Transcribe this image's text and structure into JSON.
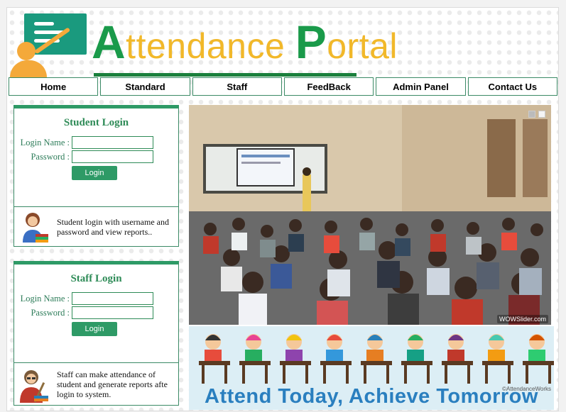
{
  "header": {
    "logo_big_letter_a": "A",
    "logo_rest_1": "ttendance ",
    "logo_big_letter_p": "P",
    "logo_rest_2": "ortal"
  },
  "nav": [
    {
      "label": "Home"
    },
    {
      "label": "Standard"
    },
    {
      "label": "Staff"
    },
    {
      "label": "FeedBack"
    },
    {
      "label": "Admin Panel"
    },
    {
      "label": "Contact Us"
    }
  ],
  "student_login": {
    "title": "Student Login",
    "login_name_label": "Login Name :",
    "password_label": "Password :",
    "login_name_value": "",
    "password_value": "",
    "button": "Login",
    "description": "Student login with username and password and view reports.."
  },
  "staff_login": {
    "title": "Staff Login",
    "login_name_label": "Login Name :",
    "password_label": "Password :",
    "login_name_value": "",
    "password_value": "",
    "button": "Login",
    "description": "Staff can make attendance of student and generate reports afte login to system."
  },
  "slider": {
    "watermark": "WOWSlider.com"
  },
  "banner": {
    "slogan": "Attend Today, Achieve Tomorrow",
    "credit": "©AttendanceWorks"
  },
  "colors": {
    "accent": "#2e9a66",
    "brand_green": "#1a9a4a",
    "brand_yellow": "#f1b82a"
  }
}
